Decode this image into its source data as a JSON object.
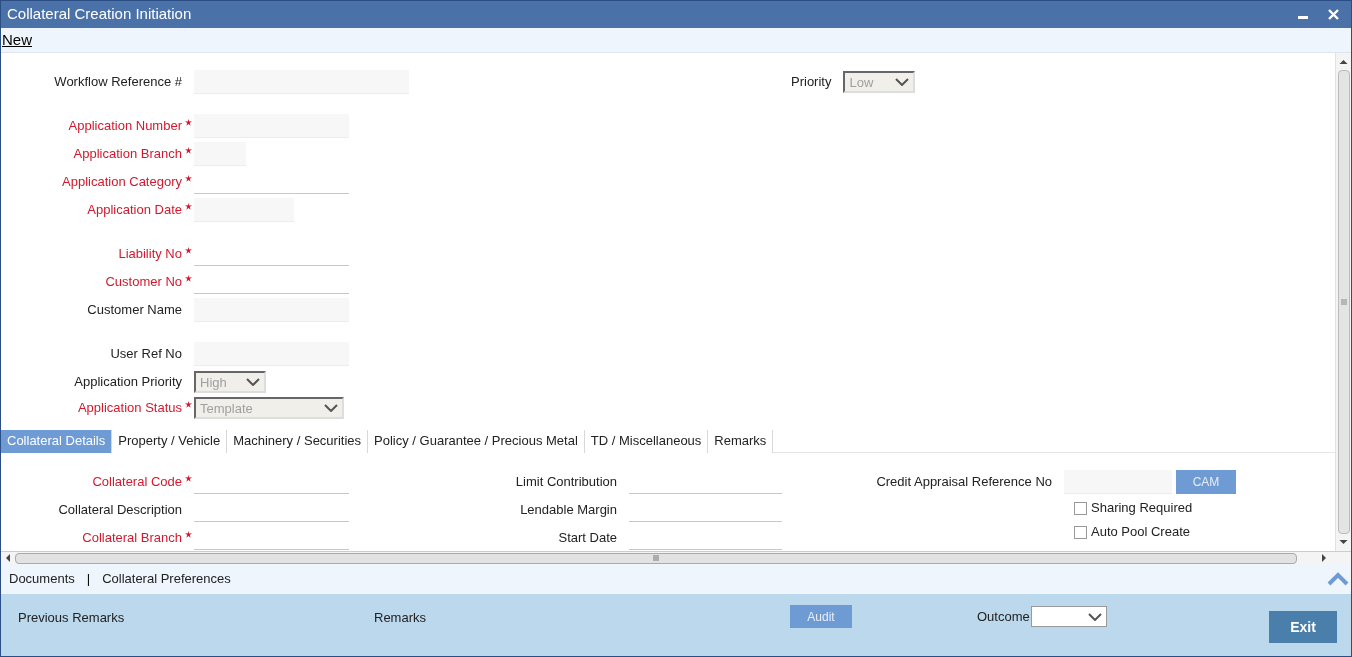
{
  "window": {
    "title": "Collateral Creation Initiation"
  },
  "toolbar": {
    "links": [
      {
        "label": "New"
      }
    ]
  },
  "form": {
    "priority": {
      "label": "Priority",
      "kind": "select",
      "value": "Low",
      "disabled": true
    },
    "groups": [
      {
        "fields": [
          {
            "label": "Workflow Reference #",
            "required": false,
            "kind": "filled"
          }
        ]
      },
      {
        "fields": [
          {
            "label": "Application Number",
            "required": true,
            "kind": "filled"
          },
          {
            "label": "Application Branch",
            "required": true,
            "kind": "filled"
          },
          {
            "label": "Application Category",
            "required": true,
            "kind": "line"
          },
          {
            "label": "Application Date",
            "required": true,
            "kind": "filled"
          }
        ]
      },
      {
        "fields": [
          {
            "label": "Liability No",
            "required": true,
            "kind": "line"
          },
          {
            "label": "Customer No",
            "required": true,
            "kind": "line"
          },
          {
            "label": "Customer Name",
            "required": false,
            "kind": "filled"
          }
        ]
      },
      {
        "fields": [
          {
            "label": "User Ref No",
            "required": false,
            "kind": "filled"
          },
          {
            "label": "Application Priority",
            "required": false,
            "kind": "select",
            "value": "High",
            "disabled": true
          },
          {
            "label": "Application Status",
            "required": true,
            "kind": "select",
            "value": "Template",
            "disabled": true
          }
        ]
      }
    ]
  },
  "tabs": [
    {
      "label": "Collateral Details",
      "selected": true
    },
    {
      "label": "Property / Vehicle",
      "selected": false
    },
    {
      "label": "Machinery / Securities",
      "selected": false
    },
    {
      "label": "Policy / Guarantee / Precious Metal",
      "selected": false
    },
    {
      "label": "TD / Miscellaneous",
      "selected": false
    },
    {
      "label": "Remarks",
      "selected": false
    }
  ],
  "tab_content": {
    "columns": [
      {
        "fields": [
          {
            "label": "Collateral Code",
            "required": true,
            "kind": "line"
          },
          {
            "label": "Collateral Description",
            "required": false,
            "kind": "line"
          },
          {
            "label": "Collateral Branch",
            "required": true,
            "kind": "line"
          }
        ]
      },
      {
        "fields": [
          {
            "label": "Limit Contribution",
            "required": false,
            "kind": "line"
          },
          {
            "label": "Lendable Margin",
            "required": false,
            "kind": "line"
          },
          {
            "label": "Start Date",
            "required": false,
            "kind": "line"
          }
        ]
      },
      {
        "fields": [
          {
            "label": "Credit Appraisal Reference No",
            "required": false,
            "kind": "filled",
            "button": "CAM"
          }
        ]
      }
    ],
    "checkboxes": [
      {
        "label": "Sharing Required",
        "checked": false
      },
      {
        "label": "Auto Pool Create",
        "checked": false
      }
    ]
  },
  "bottom_links": {
    "links": [
      {
        "label": "Documents"
      },
      {
        "label": "Collateral Preferences"
      }
    ],
    "separator": "|"
  },
  "footer": {
    "previous_remarks": "Previous Remarks",
    "remarks": "Remarks",
    "audit_button": "Audit",
    "outcome": {
      "label": "Outcome"
    },
    "exit_button": "Exit"
  }
}
